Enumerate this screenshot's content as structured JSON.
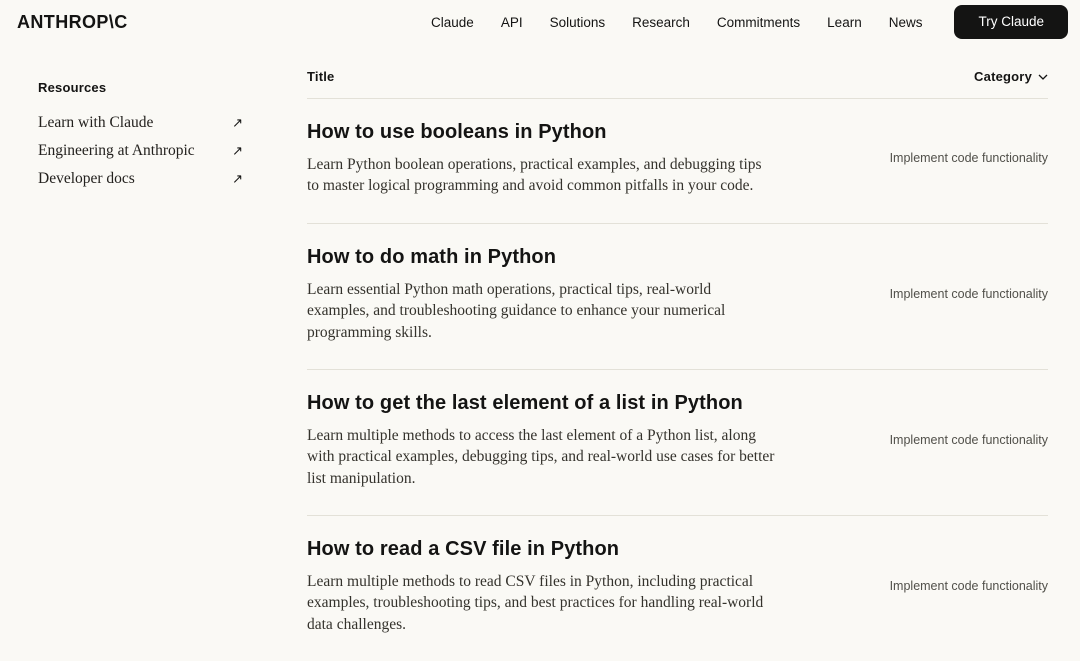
{
  "header": {
    "logo": "ANTHROP\\C",
    "nav_items": [
      "Claude",
      "API",
      "Solutions",
      "Research",
      "Commitments",
      "Learn",
      "News"
    ],
    "cta_label": "Try Claude"
  },
  "sidebar": {
    "heading": "Resources",
    "items": [
      {
        "label": "Learn with Claude",
        "icon": "external-link-arrow"
      },
      {
        "label": "Engineering at Anthropic",
        "icon": "external-link-arrow"
      },
      {
        "label": "Developer docs",
        "icon": "external-link-arrow"
      }
    ],
    "arrow_glyph": "↗"
  },
  "list": {
    "title_header": "Title",
    "category_header": "Category",
    "rows": [
      {
        "title": "How to use booleans in Python",
        "description": "Learn Python boolean operations, practical examples, and debugging tips to master logical programming and avoid common pitfalls in your code.",
        "category": "Implement code functionality"
      },
      {
        "title": "How to do math in Python",
        "description": "Learn essential Python math operations, practical tips, real-world examples, and troubleshooting guidance to enhance your numerical programming skills.",
        "category": "Implement code functionality"
      },
      {
        "title": "How to get the last element of a list in Python",
        "description": "Learn multiple methods to access the last element of a Python list, along with practical examples, debugging tips, and real-world use cases for better list manipulation.",
        "category": "Implement code functionality"
      },
      {
        "title": "How to read a CSV file in Python",
        "description": "Learn multiple methods to read CSV files in Python, including practical examples, troubleshooting tips, and best practices for handling real-world data challenges.",
        "category": "Implement code functionality"
      }
    ]
  },
  "colors": {
    "background": "#faf9f5",
    "text": "#141413",
    "button_background": "#141413",
    "button_text": "#ffffff",
    "divider": "#e3e1d8",
    "category_text": "#51504a"
  }
}
